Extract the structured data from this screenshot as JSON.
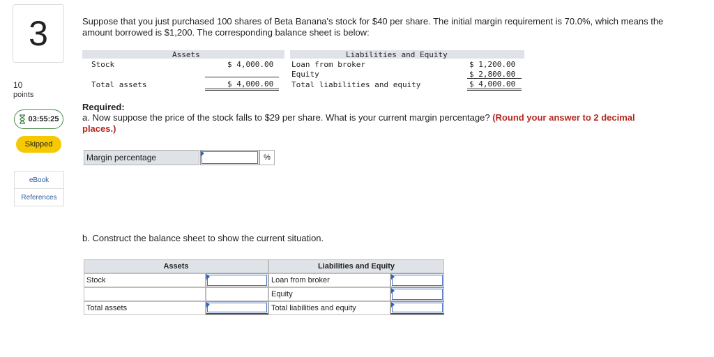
{
  "sidebar": {
    "question_number": "3",
    "points_value": "10",
    "points_label": "points",
    "timer": "03:55:25",
    "status": "Skipped",
    "links": [
      "eBook",
      "References"
    ]
  },
  "question": {
    "intro": "Suppose that you just purchased 100 shares of Beta Banana's stock for $40 per share. The initial margin requirement is 70.0%, which means the amount borrowed is $1,200. The corresponding balance sheet is below:",
    "balance_sheet": {
      "assets_header": "Assets",
      "liabilities_header": "Liabilities and Equity",
      "stock_label": "Stock",
      "stock_value": "$ 4,000.00",
      "total_assets_label": "Total assets",
      "total_assets_value": "$ 4,000.00",
      "loan_label": "Loan from broker",
      "loan_value": "$ 1,200.00",
      "equity_label": "Equity",
      "equity_value": "$ 2,800.00",
      "total_le_label": "Total liabilities and equity",
      "total_le_value": "$ 4,000.00"
    },
    "required_label": "Required:",
    "part_a_text": "a. Now suppose the price of the stock falls to $29 per share. What is your current margin percentage?",
    "part_a_note": "(Round your answer to 2 decimal places.)",
    "margin_label": "Margin percentage",
    "margin_value": "",
    "margin_unit": "%",
    "part_b_text": "b. Construct the balance sheet to show the current situation.",
    "table_b": {
      "assets_header": "Assets",
      "liabilities_header": "Liabilities and Equity",
      "stock_label": "Stock",
      "total_assets_label": "Total assets",
      "loan_label": "Loan from broker",
      "equity_label": "Equity",
      "total_le_label": "Total liabilities and equity"
    }
  },
  "colors": {
    "header_bg": "#dfe3e8",
    "skipped_bg": "#f5c800",
    "note_red": "#b5271f",
    "link_blue": "#2c5aa0",
    "input_blue": "#4a72c4"
  }
}
